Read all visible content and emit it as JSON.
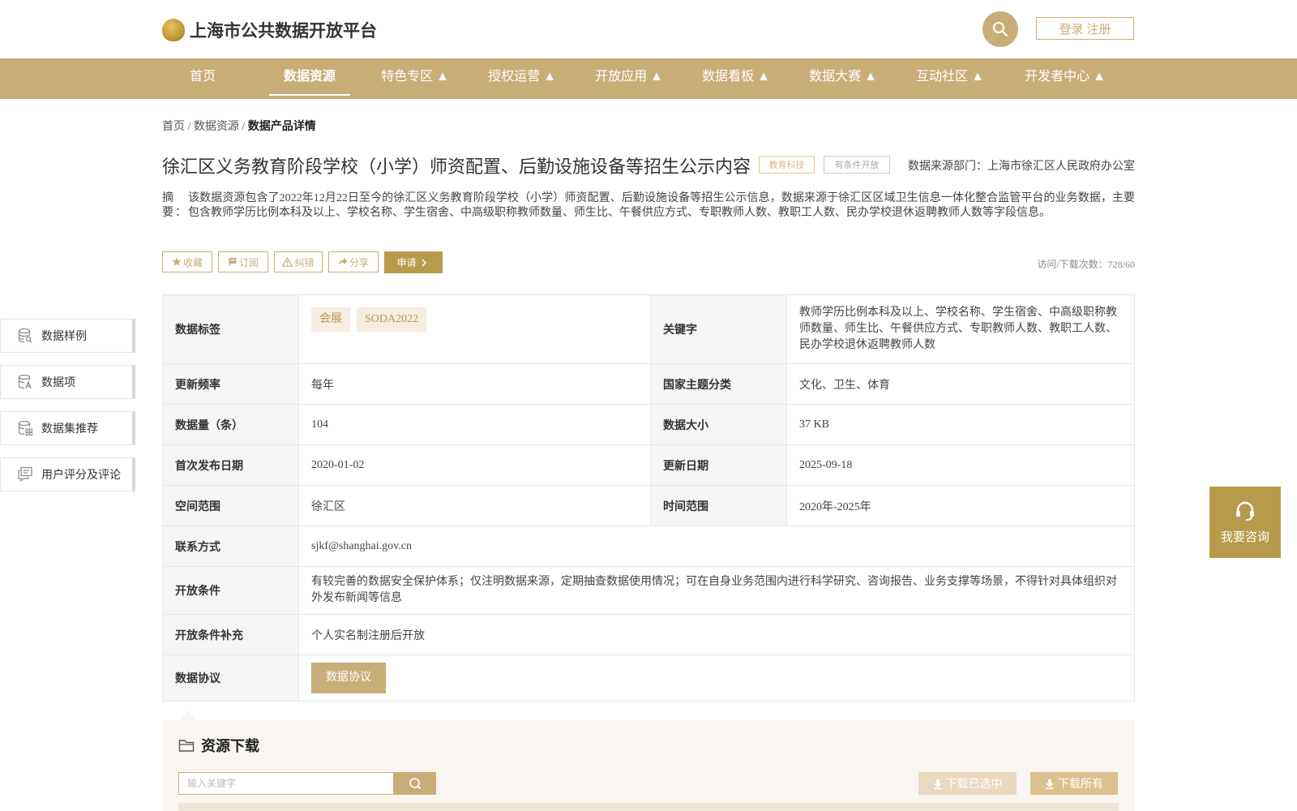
{
  "header": {
    "logo_text": "上海市公共数据开放平台",
    "login_label": "登录 注册"
  },
  "nav": [
    {
      "label": "首页",
      "active": false
    },
    {
      "label": "数据资源",
      "active": true
    },
    {
      "label": "特色专区 ▲",
      "active": false
    },
    {
      "label": "授权运营 ▲",
      "active": false
    },
    {
      "label": "开放应用 ▲",
      "active": false
    },
    {
      "label": "数据看板 ▲",
      "active": false
    },
    {
      "label": "数据大赛 ▲",
      "active": false
    },
    {
      "label": "互动社区 ▲",
      "active": false
    },
    {
      "label": "开发者中心 ▲",
      "active": false
    }
  ],
  "breadcrumb": {
    "home": "首页",
    "sep1": " / ",
    "section": "数据资源",
    "sep2": " / ",
    "current": "数据产品详情"
  },
  "dataset": {
    "title": "徐汇区义务教育阶段学校（小学）师资配置、后勤设施设备等招生公示内容",
    "tag_topic": "教育科技",
    "tag_open": "有条件开放",
    "source": "数据来源部门：上海市徐汇区人民政府办公室",
    "abstract_label": "摘要：",
    "abstract": "该数据资源包含了2022年12月22日至今的徐汇区义务教育阶段学校（小学）师资配置、后勤设施设备等招生公示信息，数据来源于徐汇区区域卫生信息一体化整合监管平台的业务数据，主要包含教师学历比例本科及以上、学校名称、学生宿舍、中高级职称教师数量、师生比、午餐供应方式、专职教师人数、教职工人数、民办学校退休返聘教师人数等字段信息。",
    "visits": "访问/下载次数：728/60"
  },
  "actions": {
    "collect": "收藏",
    "subscribe": "订阅",
    "correct": "纠错",
    "share": "分享",
    "apply": "申请"
  },
  "sidenav": [
    {
      "label": "数据样例",
      "icon": "database-search-icon"
    },
    {
      "label": "数据项",
      "icon": "database-text-icon"
    },
    {
      "label": "数据集推荐",
      "icon": "database-grid-icon"
    },
    {
      "label": "用户评分及评论",
      "icon": "comment-icon"
    }
  ],
  "info": {
    "tags_label": "数据标签",
    "tags": [
      "会展",
      "SODA2022"
    ],
    "keywords_label": "关键字",
    "keywords": "教师学历比例本科及以上、学校名称、学生宿舍、中高级职称教师数量、师生比、午餐供应方式、专职教师人数、教职工人数、民办学校退休返聘教师人数",
    "freq_label": "更新频率",
    "freq": "每年",
    "category_label": "国家主题分类",
    "category": "文化、卫生、体育",
    "count_label": "数据量（条）",
    "count": "104",
    "size_label": "数据大小",
    "size": "37 KB",
    "first_pub_label": "首次发布日期",
    "first_pub": "2020-01-02",
    "updated_label": "更新日期",
    "updated": "2025-09-18",
    "spatial_label": "空间范围",
    "spatial": "徐汇区",
    "temporal_label": "时间范围",
    "temporal": "2020年-2025年",
    "contact_label": "联系方式",
    "contact": "sjkf@shanghai.gov.cn",
    "condition_label": "开放条件",
    "condition": "有较完善的数据安全保护体系；仅注明数据来源，定期抽查数据使用情况；可在自身业务范围内进行科学研究、咨询报告、业务支撑等场景，不得针对具体组织对外发布新闻等信息",
    "condition_extra_label": "开放条件补充",
    "condition_extra": "个人实名制注册后开放",
    "agreement_label": "数据协议",
    "agreement_btn": "数据协议"
  },
  "consult": {
    "label": "我要咨询"
  },
  "download": {
    "title": "资源下载",
    "search_placeholder": "输入关键字",
    "download_selected": "下载已选中",
    "download_all": "下载所有"
  },
  "colors": {
    "accent": "#c9ad79",
    "accent_dark": "#b89a4c",
    "chip_bg": "#f5ede0"
  }
}
